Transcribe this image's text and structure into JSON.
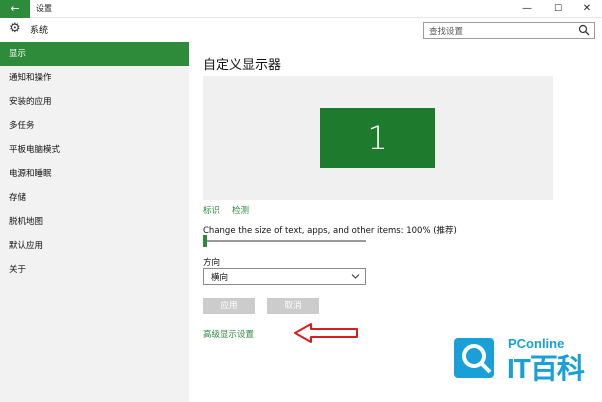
{
  "window": {
    "back_icon": "←",
    "title": "设置",
    "min_icon": "—",
    "max_icon": "☐",
    "close_icon": "✕"
  },
  "header": {
    "app_icon": "⚙",
    "app_name": "系统",
    "search_placeholder": "查找设置"
  },
  "sidebar": {
    "items": [
      {
        "label": "显示"
      },
      {
        "label": "通知和操作"
      },
      {
        "label": "安装的应用"
      },
      {
        "label": "多任务"
      },
      {
        "label": "平板电脑模式"
      },
      {
        "label": "电源和睡眠"
      },
      {
        "label": "存储"
      },
      {
        "label": "脱机地图"
      },
      {
        "label": "默认应用"
      },
      {
        "label": "关于"
      }
    ]
  },
  "main": {
    "title": "自定义显示器",
    "monitor_number": "1",
    "identify_link": "标识",
    "detect_link": "检测",
    "scale_label": "Change the size of text, apps, and other items: 100% (推荐)",
    "scale_value_percent": 100,
    "orientation_label": "方向",
    "orientation_value": "横向",
    "apply_button": "应用",
    "cancel_button": "取消",
    "advanced_link": "高级显示设置"
  },
  "watermark": {
    "brand": "PConline",
    "sub": "IT百科"
  },
  "colors": {
    "accent": "#2e8b3a",
    "monitor": "#1e7a2c",
    "arrow": "#d62020",
    "watermark": "#1aa0d8"
  }
}
